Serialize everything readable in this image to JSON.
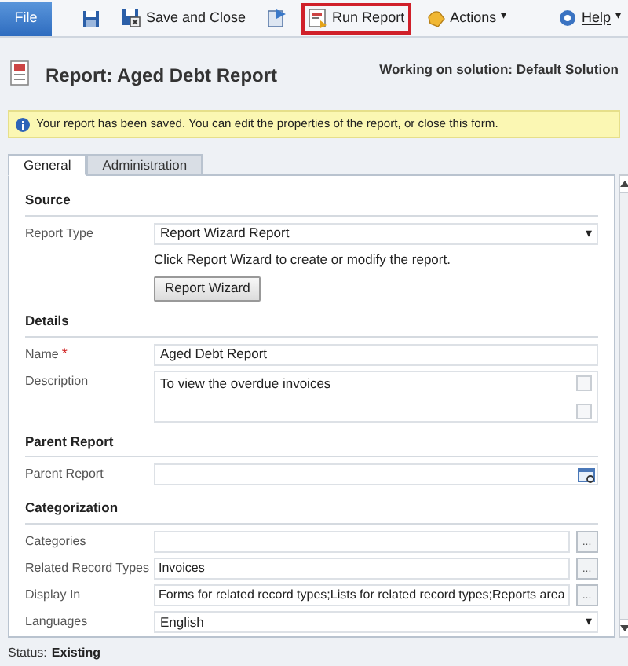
{
  "toolbar": {
    "file": "File",
    "items": [
      {
        "kind": "save"
      },
      {
        "kind": "save_close",
        "label": "Save and Close"
      },
      {
        "kind": "assign"
      },
      {
        "kind": "run",
        "label": "Run Report",
        "highlighted": true
      },
      {
        "kind": "actions",
        "label": "Actions",
        "caret": "▾"
      }
    ],
    "help": {
      "label": "Help",
      "caret": "▾"
    }
  },
  "header": {
    "title": "Report: Aged Debt Report",
    "solution": "Working on solution: Default Solution"
  },
  "notice": "Your report has been saved. You can edit the properties of the report, or close this form.",
  "tabs": [
    {
      "label": "General",
      "selected": true
    },
    {
      "label": "Administration",
      "selected": false
    }
  ],
  "sections": [
    {
      "title": "Source",
      "rows": [
        {
          "kind": "select",
          "label": "Report Type",
          "value": "Report Wizard Report",
          "caret": "▾"
        },
        {
          "kind": "note",
          "text": "Click Report Wizard to create or modify the report."
        },
        {
          "kind": "button",
          "text": "Report Wizard"
        }
      ]
    },
    {
      "title": "Details",
      "rows": [
        {
          "kind": "text",
          "label": "Name",
          "required_mark": "*",
          "value": "Aged Debt Report"
        },
        {
          "kind": "textarea",
          "label": "Description",
          "value": "To view the overdue invoices"
        }
      ]
    },
    {
      "title": "Parent Report",
      "rows": [
        {
          "kind": "lookup",
          "label": "Parent Report"
        }
      ]
    },
    {
      "title": "Categorization",
      "rows": [
        {
          "kind": "multi",
          "label": "Categories",
          "button": "..."
        },
        {
          "kind": "multi",
          "label": "Related Record Types",
          "value": "Invoices",
          "button": "..."
        },
        {
          "kind": "multi",
          "label": "Display In",
          "value": "Forms for related record types;Lists for related record types;Reports area",
          "button": "..."
        },
        {
          "kind": "select",
          "label": "Languages",
          "value": "English",
          "caret": "▾"
        }
      ]
    }
  ],
  "status": {
    "label": "Status:",
    "value": "Existing"
  }
}
